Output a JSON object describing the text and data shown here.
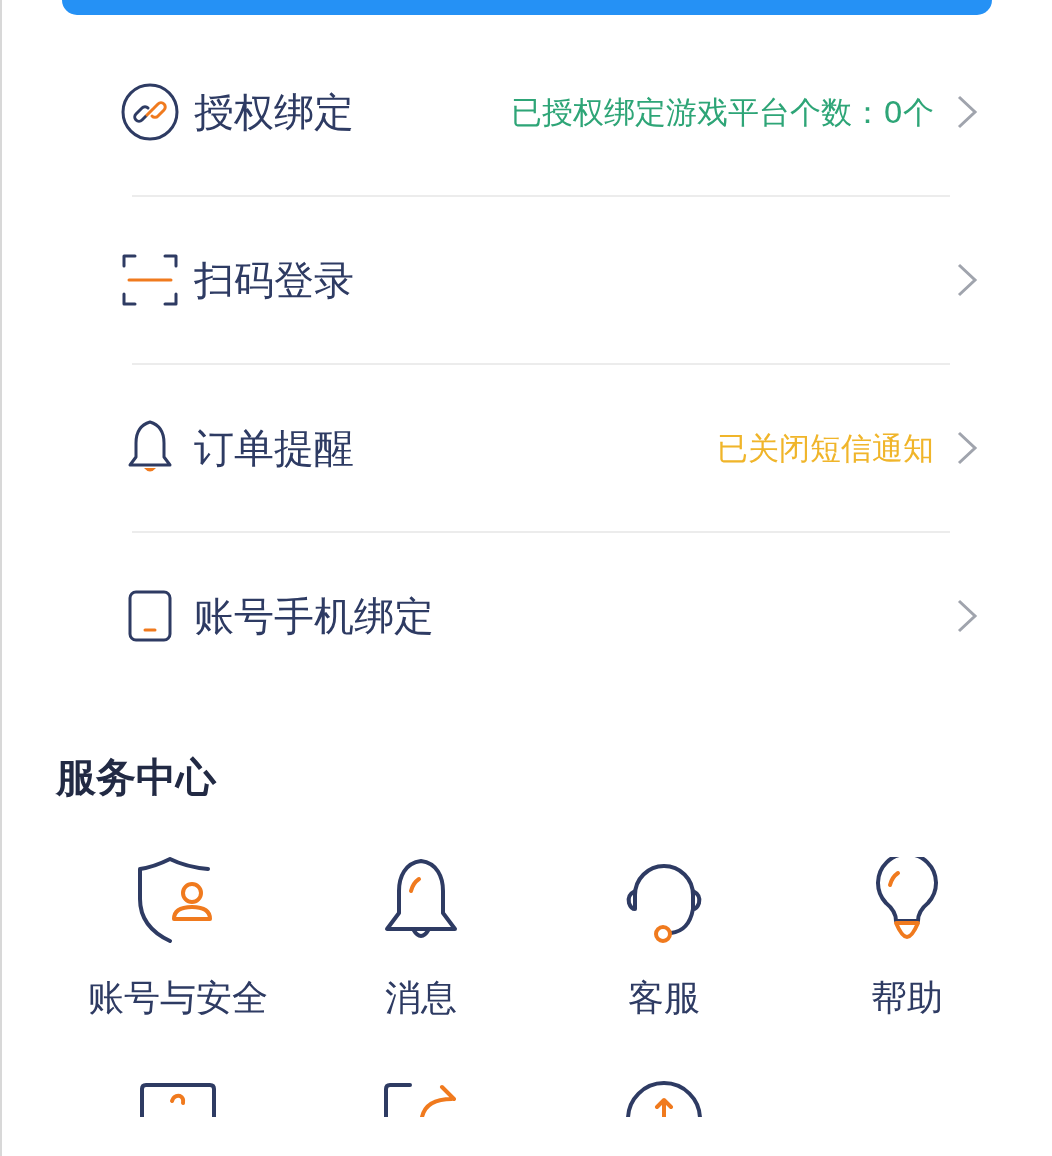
{
  "settings": [
    {
      "label": "授权绑定",
      "status": {
        "text": "已授权绑定游戏平台个数：0个",
        "color": "#2ea577"
      }
    },
    {
      "label": "扫码登录"
    },
    {
      "label": "订单提醒",
      "status": {
        "text": "已关闭短信通知",
        "color": "#f0b52a"
      }
    },
    {
      "label": "账号手机绑定"
    }
  ],
  "service_center": {
    "title": "服务中心",
    "items": [
      {
        "kind": "labeled",
        "label": "账号与安全"
      },
      {
        "kind": "labeled",
        "label": "消息"
      },
      {
        "kind": "labeled",
        "label": "客服"
      },
      {
        "kind": "labeled",
        "label": "帮助"
      },
      {
        "kind": "cut"
      },
      {
        "kind": "cut"
      },
      {
        "kind": "cut"
      }
    ]
  }
}
